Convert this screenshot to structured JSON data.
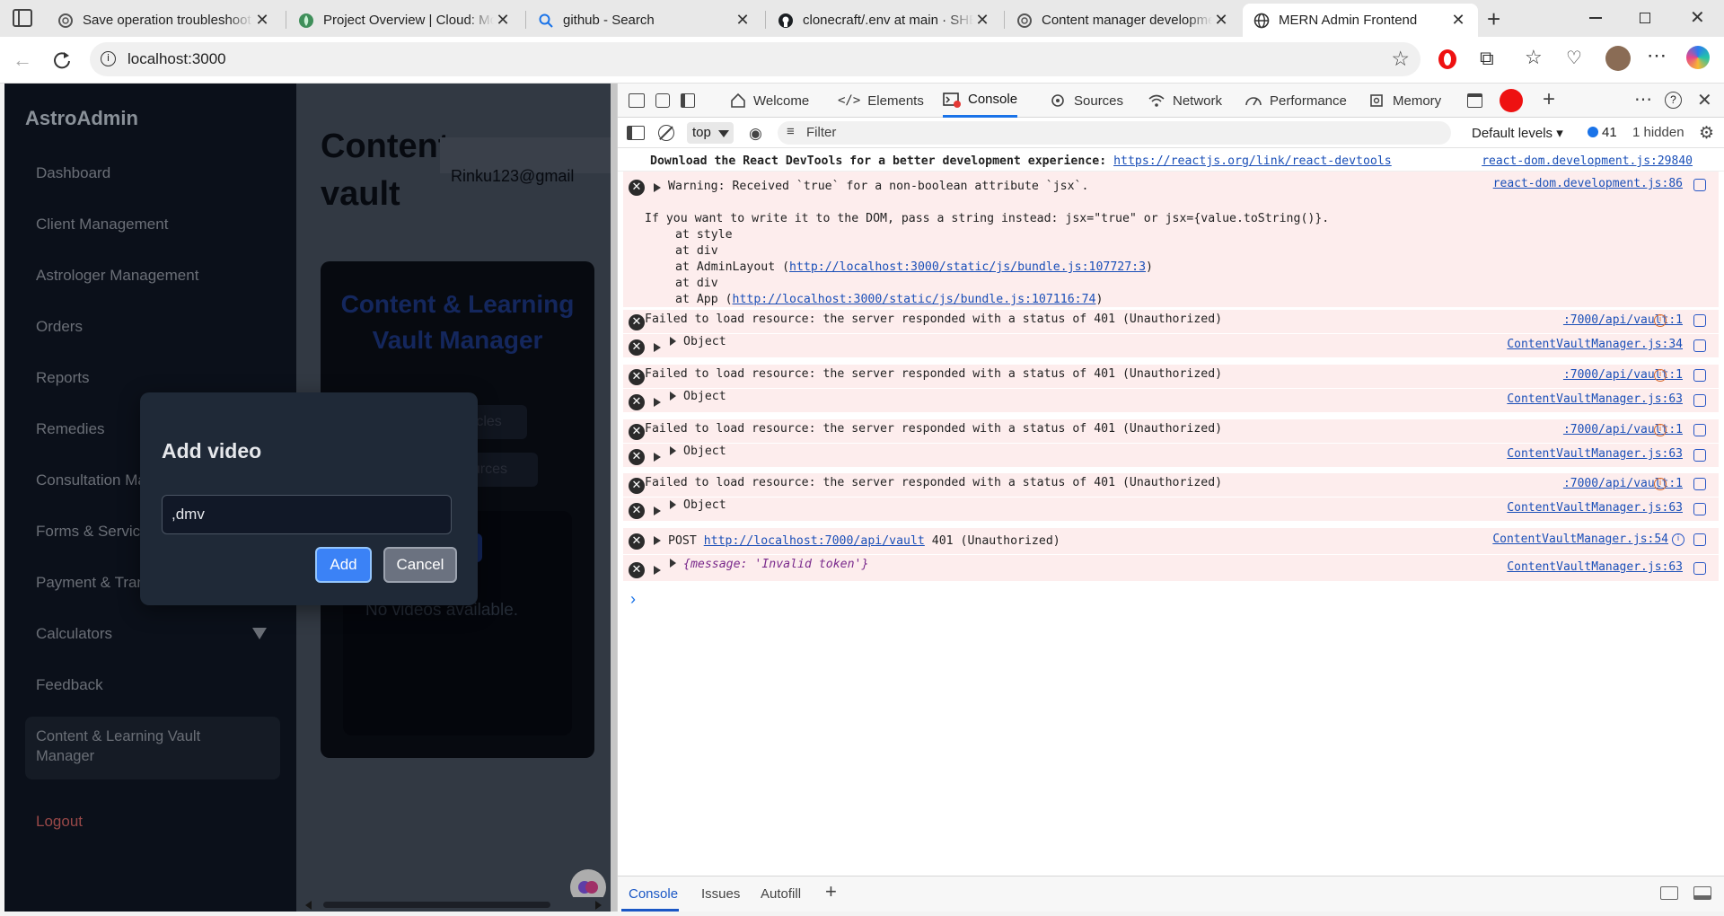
{
  "browser": {
    "tabs": [
      {
        "title": "Save operation troubleshoot"
      },
      {
        "title": "Project Overview | Cloud: Mo"
      },
      {
        "title": "github - Search"
      },
      {
        "title": "clonecraft/.env at main · SHE"
      },
      {
        "title": "Content manager developme"
      },
      {
        "title": "MERN Admin Frontend"
      }
    ],
    "url": "localhost:3000"
  },
  "app": {
    "brand": "AstroAdmin",
    "nav": [
      "Dashboard",
      "Client Management",
      "Astrologer Management",
      "Orders",
      "Reports",
      "Remedies",
      "Consultation Ma",
      "Forms & Servic",
      "Payment & Tran",
      "Calculators",
      "Feedback",
      "Content & Learning Vault Manager",
      "Logout"
    ],
    "page_title": "Content-vault",
    "user_email": "Rinku123@gmail",
    "vault_heading": "Content & Learning Vault Manager",
    "bg_tab_articles": "rticles",
    "bg_tab_resources": "ources",
    "no_videos": "No videos available.",
    "modal": {
      "title": "Add video",
      "input_value": ",dmv",
      "add_label": "Add",
      "cancel_label": "Cancel"
    }
  },
  "devtools": {
    "tabs": [
      "Welcome",
      "Elements",
      "Console",
      "Sources",
      "Network",
      "Performance",
      "Memory"
    ],
    "context": "top",
    "filter_placeholder": "Filter",
    "levels": "Default levels",
    "issues_count": "41",
    "hidden": "1 hidden",
    "drawer_tabs": [
      "Console",
      "Issues",
      "Autofill"
    ],
    "logs": {
      "devtools_msg": "Download the React DevTools for a better development experience: ",
      "devtools_link": "https://reactjs.org/link/react-devtools",
      "devtools_src": "react-dom.development.js:29840",
      "warn_line": "Warning: Received `true` for a non-boolean attribute `jsx`.",
      "warn_src": "react-dom.development.js:86",
      "warn_detail": "If you want to write it to the DOM, pass a string instead: jsx=\"true\" or jsx={value.toString()}.",
      "stack_style": "at style",
      "stack_div": "at div",
      "stack_admin_prefix": "at AdminLayout (",
      "stack_admin_link": "http://localhost:3000/static/js/bundle.js:107727:3",
      "stack_div2": "at div",
      "stack_app_prefix": "at App (",
      "stack_app_link": "http://localhost:3000/static/js/bundle.js:107116:74",
      "close_paren": ")",
      "failed": "Failed to load resource: the server responded with a status of 401 (Unauthorized)",
      "vault_src": ":7000/api/vault:1",
      "object": "Object",
      "src34": "ContentVaultManager.js:34",
      "src63": "ContentVaultManager.js:63",
      "src54": "ContentVaultManager.js:54",
      "post_prefix": "POST ",
      "post_link": "http://localhost:7000/api/vault",
      "post_status": " 401 (Unauthorized)",
      "msg_obj": "{message: 'Invalid token'}"
    }
  },
  "colors": {
    "sidebar_bg": "#111827",
    "modal_bg": "#1f2937",
    "accent_blue": "#3b82f6",
    "error_bg": "#fdeded"
  }
}
